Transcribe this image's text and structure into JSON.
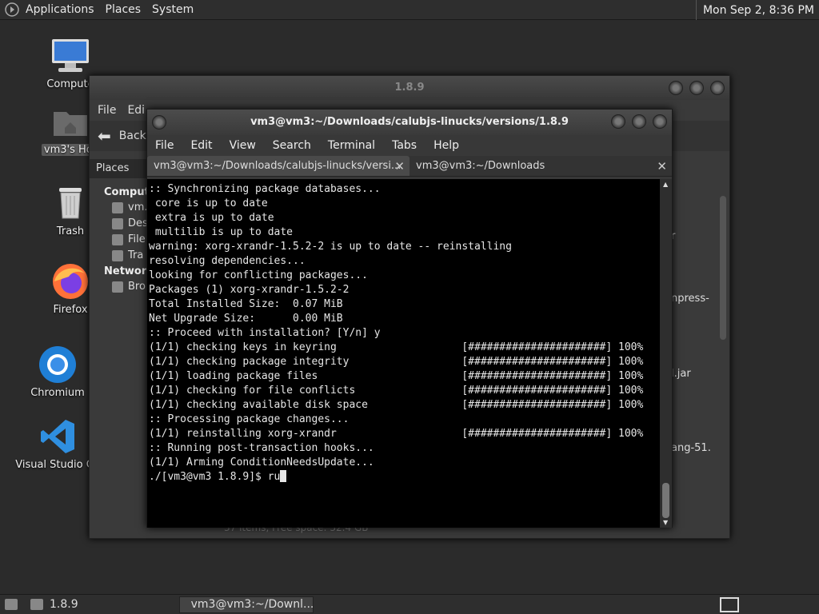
{
  "top_panel": {
    "menus": [
      "Applications",
      "Places",
      "System"
    ],
    "clock": "Mon Sep  2,  8:36 PM"
  },
  "desktop_icons": [
    {
      "label": "Compute"
    },
    {
      "label": "vm3's Hor"
    },
    {
      "label": "Trash"
    },
    {
      "label": "Firefox"
    },
    {
      "label": "Chromium"
    },
    {
      "label": "Visual Studio Co"
    }
  ],
  "file_manager": {
    "title": "1.8.9",
    "menus": [
      "File",
      "Edi"
    ],
    "back_label": "Back",
    "places_header": "Places",
    "groups": [
      {
        "name": "Compute",
        "items": [
          "vm.",
          "Des",
          "File",
          "Tra"
        ]
      },
      {
        "name": "Network",
        "items": [
          "Bro"
        ]
      }
    ],
    "fragments": [
      "r",
      "npress-",
      "l.jar",
      "ang-51."
    ],
    "status": "37 items, Free space: 32.4 GB"
  },
  "terminal": {
    "title": "vm3@vm3:~/Downloads/calubjs-linucks/versions/1.8.9",
    "menus": [
      "File",
      "Edit",
      "View",
      "Search",
      "Terminal",
      "Tabs",
      "Help"
    ],
    "tabs": [
      {
        "label": "vm3@vm3:~/Downloads/calubjs-linucks/versi...",
        "active": true
      },
      {
        "label": "vm3@vm3:~/Downloads",
        "active": false
      }
    ],
    "lines": [
      ":: Synchronizing package databases...",
      " core is up to date",
      " extra is up to date",
      " multilib is up to date",
      "warning: xorg-xrandr-1.5.2-2 is up to date -- reinstalling",
      "resolving dependencies...",
      "looking for conflicting packages...",
      "",
      "Packages (1) xorg-xrandr-1.5.2-2",
      "",
      "Total Installed Size:  0.07 MiB",
      "Net Upgrade Size:      0.00 MiB",
      "",
      ":: Proceed with installation? [Y/n] y",
      "(1/1) checking keys in keyring                    [######################] 100%",
      "(1/1) checking package integrity                  [######################] 100%",
      "(1/1) loading package files                       [######################] 100%",
      "(1/1) checking for file conflicts                 [######################] 100%",
      "(1/1) checking available disk space               [######################] 100%",
      ":: Processing package changes...",
      "(1/1) reinstalling xorg-xrandr                    [######################] 100%",
      ":: Running post-transaction hooks...",
      "(1/1) Arming ConditionNeedsUpdate..."
    ],
    "prompt": "./[vm3@vm3 1.8.9]$ ru"
  },
  "bottom_panel": {
    "folder_label": "1.8.9",
    "task_label": "vm3@vm3:~/Downl..."
  }
}
